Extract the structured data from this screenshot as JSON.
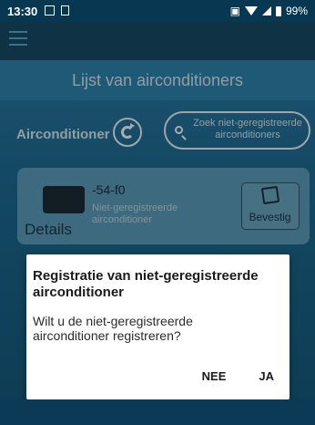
{
  "status": {
    "time": "13:30",
    "battery_percent": "99%",
    "icons": [
      "image-icon",
      "document-icon",
      "vibrate-icon",
      "wifi-icon",
      "signal-icon",
      "battery-icon"
    ]
  },
  "header": {
    "menu_icon": "hamburger-menu-icon",
    "title": "Lijst van airconditioners"
  },
  "filter": {
    "label": "Airconditioner",
    "refresh_icon": "refresh-icon",
    "search_icon": "search-icon",
    "search_button": "Zoek niet-geregistreerde airconditioners"
  },
  "list": [
    {
      "name": "-54-f0",
      "status": "Niet-geregistreerde airconditioner",
      "details_label": "Details",
      "details_icon": "air-conditioner-icon",
      "confirm_label": "Bevestig",
      "confirm_icon": "edit-document-icon"
    }
  ],
  "dialog": {
    "title": "Registratie van niet-geregistreerde airconditioner",
    "message": "Wilt u de niet-geregistreerde airconditioner registreren?",
    "negative": "NEE",
    "positive": "JA"
  },
  "colors": {
    "statusbar": "#083751",
    "toolbar": "#174c67",
    "title_bar": "#2d86b1",
    "background": "#1d6b93",
    "card": "#5b9fbe",
    "dialog": "#ffffff"
  }
}
